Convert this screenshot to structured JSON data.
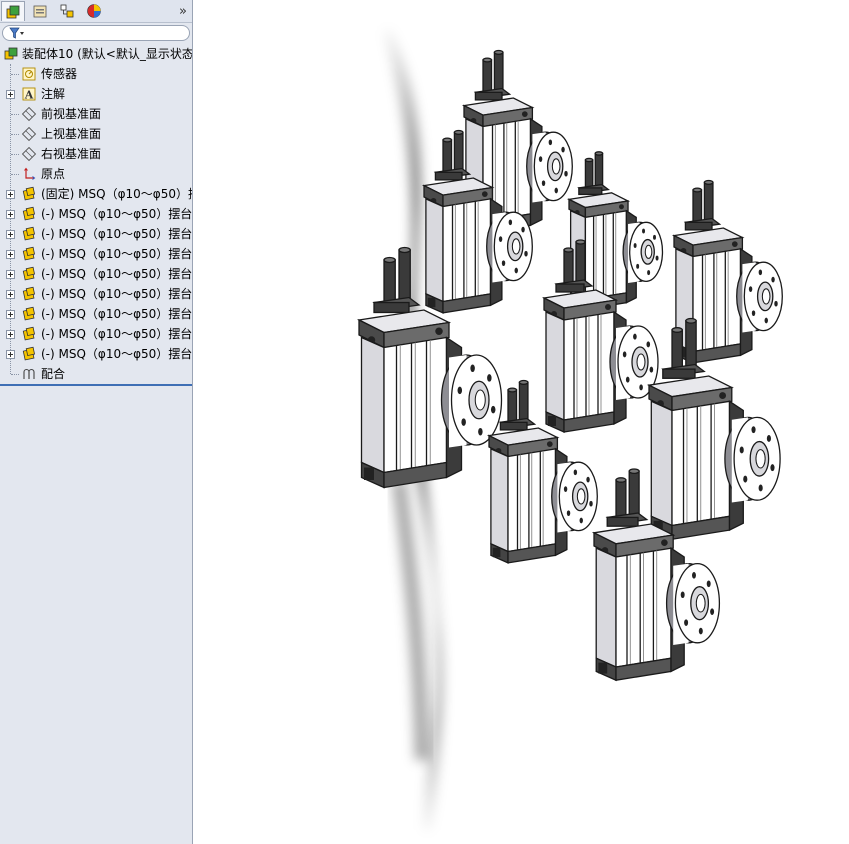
{
  "feature_manager": {
    "tabs": [
      {
        "name": "feature-tree",
        "icon": "assembly-tree-icon"
      },
      {
        "name": "property-manager",
        "icon": "property-manager-icon"
      },
      {
        "name": "configuration-manager",
        "icon": "configuration-manager-icon"
      },
      {
        "name": "display-manager",
        "icon": "display-manager-icon"
      }
    ],
    "expand_glyph": "»",
    "filter_glyph": "▾",
    "tree": {
      "root": "装配体10  (默认<默认_显示状态",
      "items": [
        {
          "label": "传感器",
          "icon": "sensor-icon",
          "expandable": false
        },
        {
          "label": "注解",
          "icon": "annotation-icon",
          "expandable": true
        },
        {
          "label": "前视基准面",
          "icon": "plane-icon",
          "expandable": false
        },
        {
          "label": "上视基准面",
          "icon": "plane-icon",
          "expandable": false
        },
        {
          "label": "右视基准面",
          "icon": "plane-icon",
          "expandable": false
        },
        {
          "label": "原点",
          "icon": "origin-icon",
          "expandable": false
        },
        {
          "label": "(固定) MSQ（φ10～φ50）摆",
          "icon": "subassembly-icon",
          "expandable": true
        },
        {
          "label": "(-) MSQ（φ10～φ50）摆台",
          "icon": "subassembly-icon",
          "expandable": true
        },
        {
          "label": "(-) MSQ（φ10～φ50）摆台",
          "icon": "subassembly-icon",
          "expandable": true
        },
        {
          "label": "(-) MSQ（φ10～φ50）摆台",
          "icon": "subassembly-icon",
          "expandable": true
        },
        {
          "label": "(-) MSQ（φ10～φ50）摆台",
          "icon": "subassembly-icon",
          "expandable": true
        },
        {
          "label": "(-) MSQ（φ10～φ50）摆台",
          "icon": "subassembly-icon",
          "expandable": true
        },
        {
          "label": "(-) MSQ（φ10～φ50）摆台",
          "icon": "subassembly-icon",
          "expandable": true
        },
        {
          "label": "(-) MSQ（φ10～φ50）摆台",
          "icon": "subassembly-icon",
          "expandable": true
        },
        {
          "label": "(-) MSQ（φ10～φ50）摆台",
          "icon": "subassembly-icon",
          "expandable": true
        },
        {
          "label": "配合",
          "icon": "mates-icon",
          "expandable": false
        }
      ]
    }
  },
  "viewport": {
    "model": "rotary-table-actuator-array",
    "actuator_count": 9,
    "colors": {
      "body": "#ffffff",
      "outline": "#1a1a1a",
      "dark": "#3a3a3a",
      "shadow": "#2b2b2b"
    }
  }
}
